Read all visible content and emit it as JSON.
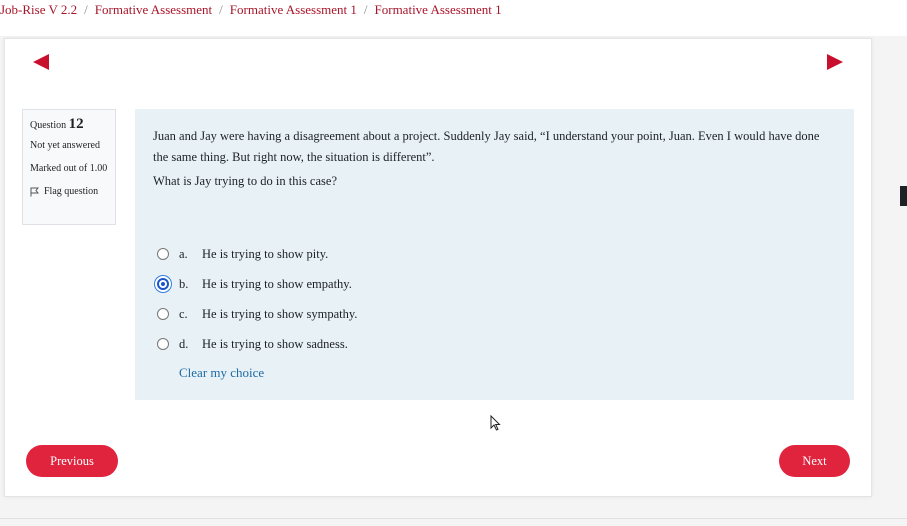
{
  "breadcrumb": {
    "items": [
      "Job-Rise V 2.2",
      "Formative Assessment",
      "Formative Assessment 1",
      "Formative Assessment 1"
    ],
    "separator": "/"
  },
  "question_info": {
    "label": "Question",
    "number": "12",
    "state": "Not yet answered",
    "grade": "Marked out of 1.00",
    "flag_label": "Flag question"
  },
  "question": {
    "text": "Juan and Jay were having a disagreement about a project.  Suddenly Jay said, “I understand your point, Juan.  Even I would have done the same thing.  But right now, the situation is different”.",
    "prompt": "What is Jay trying to do in this case?",
    "answers": [
      {
        "letter": "a.",
        "text": "He is trying to show pity.",
        "selected": false
      },
      {
        "letter": "b.",
        "text": "He is trying to show empathy.",
        "selected": true
      },
      {
        "letter": "c.",
        "text": "He is trying to show sympathy.",
        "selected": false
      },
      {
        "letter": "d.",
        "text": "He is trying to show sadness.",
        "selected": false
      }
    ],
    "clear_label": "Clear my choice"
  },
  "navigation": {
    "previous_label": "Previous",
    "next_label": "Next"
  },
  "colors": {
    "accent": "#e0243e",
    "arrow": "#c8102e",
    "link": "#1f6aa5",
    "question_bg": "#e7f1f6"
  }
}
